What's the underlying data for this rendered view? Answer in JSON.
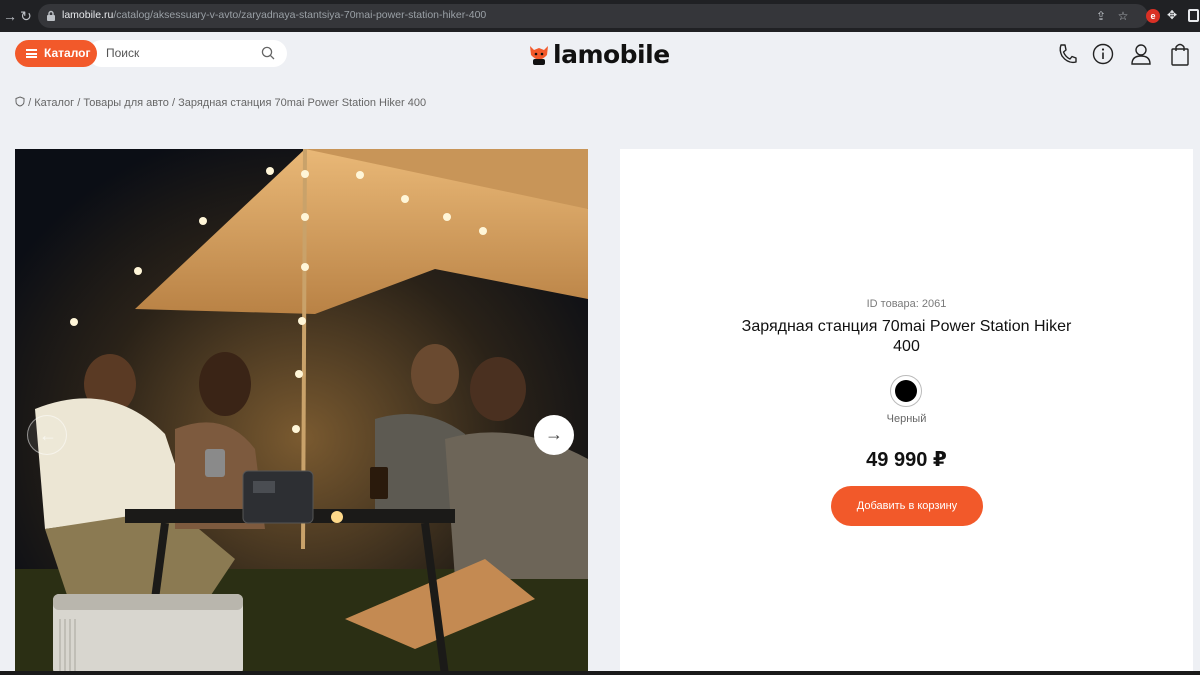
{
  "browser": {
    "url_domain": "lamobile.ru",
    "url_path": "/catalog/aksessuary-v-avto/zaryadnaya-stantsiya-70mai-power-station-hiker-400",
    "extension_badge": "e"
  },
  "header": {
    "catalog_label": "Каталог",
    "search_placeholder": "Поиск",
    "logo_text": "lamobile",
    "icons": [
      "phone-icon",
      "info-icon",
      "user-icon",
      "bag-icon"
    ]
  },
  "breadcrumb": {
    "home_icon": "shield-icon",
    "sep": "/",
    "items": [
      "Каталог",
      "Товары для авто",
      "Зарядная станция 70mai Power Station Hiker 400"
    ]
  },
  "gallery": {
    "prev_glyph": "←",
    "next_glyph": "→"
  },
  "product": {
    "id_label": "ID товара: 2061",
    "title": "Зарядная станция 70mai Power Station Hiker 400",
    "color_name": "Черный",
    "color_hex": "#000000",
    "price": "49 990 ₽",
    "add_to_cart": "Добавить в корзину"
  },
  "colors": {
    "accent": "#f2592a",
    "page_bg": "#eef0f4"
  }
}
